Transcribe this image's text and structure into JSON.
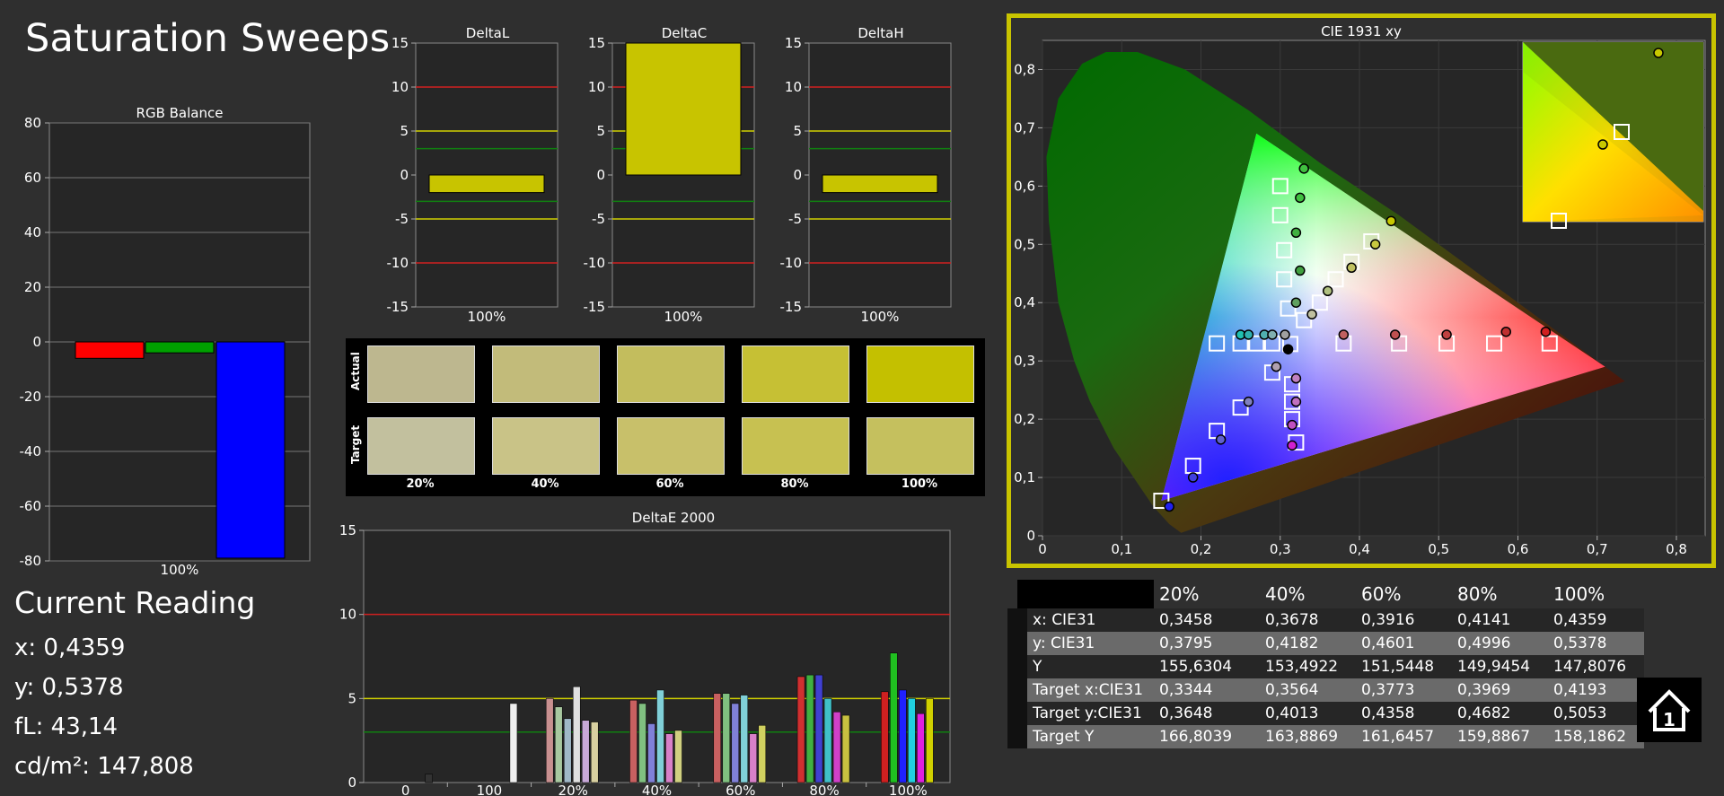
{
  "page": {
    "title": "Saturation Sweeps"
  },
  "rgb_balance": {
    "title": "RGB Balance",
    "ticks": [
      "80",
      "60",
      "40",
      "20",
      "0",
      "-20",
      "-40",
      "-60",
      "-80"
    ],
    "xlabel": "100%",
    "chart_data": {
      "type": "bar",
      "categories": [
        "R",
        "G",
        "B"
      ],
      "values": [
        -6,
        -4,
        -79
      ],
      "ylim": [
        -80,
        80
      ],
      "colors": [
        "#ff0000",
        "#00a000",
        "#0000ff"
      ]
    }
  },
  "delta_l": {
    "title": "DeltaL",
    "xlabel": "100%",
    "ticks": [
      "15",
      "10",
      "5",
      "0",
      "-5",
      "-10",
      "-15"
    ],
    "chart_data": {
      "type": "bar",
      "categories": [
        "100%"
      ],
      "values": [
        -2
      ],
      "ylim": [
        -15,
        15
      ]
    }
  },
  "delta_c": {
    "title": "DeltaC",
    "xlabel": "100%",
    "ticks": [
      "15",
      "10",
      "5",
      "0",
      "-5",
      "-10",
      "-15"
    ],
    "chart_data": {
      "type": "bar",
      "categories": [
        "100%"
      ],
      "values": [
        15
      ],
      "ylim": [
        -15,
        15
      ]
    }
  },
  "delta_h": {
    "title": "DeltaH",
    "xlabel": "100%",
    "ticks": [
      "15",
      "10",
      "5",
      "0",
      "-5",
      "-10",
      "-15"
    ],
    "chart_data": {
      "type": "bar",
      "categories": [
        "100%"
      ],
      "values": [
        -2
      ],
      "ylim": [
        -15,
        15
      ]
    }
  },
  "swatches": {
    "actual_label": "Actual",
    "target_label": "Target",
    "labels": [
      "20%",
      "40%",
      "60%",
      "80%",
      "100%"
    ],
    "actual_colors": [
      "#bdb78f",
      "#c2bb7a",
      "#c3bd5d",
      "#c6c034",
      "#c4c000"
    ],
    "target_colors": [
      "#c2c09e",
      "#c9c387",
      "#c8c06a",
      "#c7c151",
      "#c5c05e"
    ]
  },
  "delta_e": {
    "title": "DeltaE 2000",
    "ticks": [
      "15",
      "10",
      "5",
      "0"
    ],
    "categories": [
      "0",
      "100",
      "20%",
      "40%",
      "60%",
      "80%",
      "100%"
    ],
    "chart_data": {
      "type": "bar",
      "ylim": [
        0,
        15
      ],
      "categories": [
        "0",
        "100",
        "20%",
        "40%",
        "60%",
        "80%",
        "100%"
      ],
      "series": [
        {
          "values": [
            0.5,
            4.7,
            5.0,
            4.9,
            5.3,
            6.3,
            5.4
          ]
        },
        {
          "values": [
            null,
            null,
            4.5,
            4.7,
            5.3,
            6.4,
            7.7
          ]
        },
        {
          "values": [
            null,
            null,
            3.8,
            3.5,
            4.7,
            6.4,
            5.5
          ]
        },
        {
          "values": [
            null,
            null,
            5.7,
            5.5,
            5.2,
            5.0,
            5.0
          ]
        },
        {
          "values": [
            null,
            null,
            3.7,
            2.9,
            2.9,
            4.2,
            4.1
          ]
        },
        {
          "values": [
            null,
            null,
            3.6,
            3.1,
            3.4,
            4.0,
            5.0
          ]
        }
      ]
    }
  },
  "cie": {
    "title": "CIE 1931 xy",
    "yticks": [
      "0,8",
      "0,7",
      "0,6",
      "0,5",
      "0,4",
      "0,3",
      "0,2",
      "0,1",
      "0"
    ],
    "xticks": [
      "0",
      "0,1",
      "0,2",
      "0,3",
      "0,4",
      "0,5",
      "0,6",
      "0,7",
      "0,8"
    ]
  },
  "reading": {
    "title": "Current Reading",
    "x": "x: 0,4359",
    "y": "y: 0,5378",
    "fl": "fL: 43,14",
    "cd": "cd/m²: 147,808"
  },
  "table": {
    "headers": [
      "20%",
      "40%",
      "60%",
      "80%",
      "100%"
    ],
    "rows": [
      {
        "label": "x: CIE31",
        "values": [
          "0,3458",
          "0,3678",
          "0,3916",
          "0,4141",
          "0,4359"
        ]
      },
      {
        "label": "y: CIE31",
        "values": [
          "0,3795",
          "0,4182",
          "0,4601",
          "0,4996",
          "0,5378"
        ]
      },
      {
        "label": "Y",
        "values": [
          "155,6304",
          "153,4922",
          "151,5448",
          "149,9454",
          "147,8076"
        ]
      },
      {
        "label": "Target x:CIE31",
        "values": [
          "0,3344",
          "0,3564",
          "0,3773",
          "0,3969",
          "0,4193"
        ]
      },
      {
        "label": "Target y:CIE31",
        "values": [
          "0,3648",
          "0,4013",
          "0,4358",
          "0,4682",
          "0,5053"
        ]
      },
      {
        "label": "Target Y",
        "values": [
          "166,8039",
          "163,8869",
          "161,6457",
          "159,8867",
          "158,1862"
        ]
      }
    ]
  },
  "home_button": {
    "icon": "home-icon"
  }
}
